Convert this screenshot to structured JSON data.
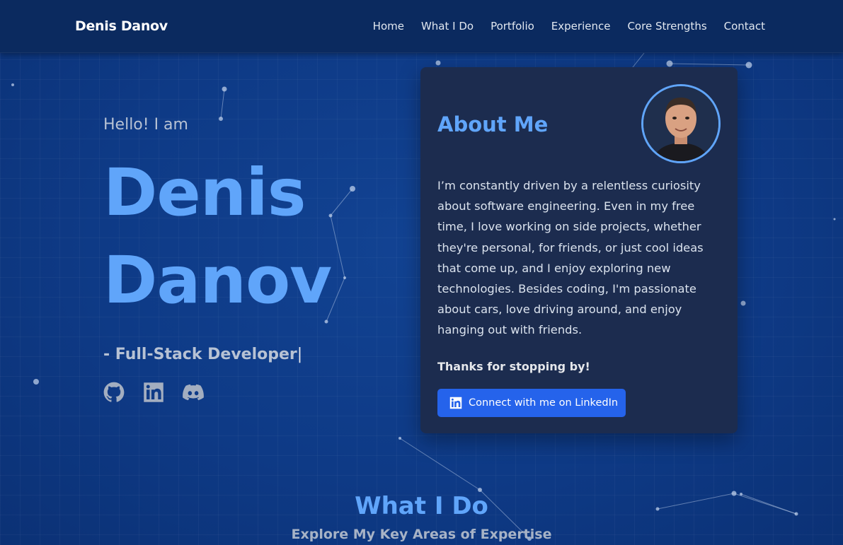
{
  "nav": {
    "brand": "Denis Danov",
    "links": [
      "Home",
      "What I Do",
      "Portfolio",
      "Experience",
      "Core Strengths",
      "Contact"
    ]
  },
  "hero": {
    "greeting": "Hello! I am",
    "first_name": "Denis",
    "last_name": "Danov",
    "subtitle": "- Full-Stack Developer",
    "cursor": "|",
    "socials": [
      "github-icon",
      "linkedin-icon",
      "discord-icon"
    ]
  },
  "about": {
    "title": "About Me",
    "text": "I’m constantly driven by a relentless curiosity about software engineering. Even in my free time, I love working on side projects, whether they're personal, for friends, or just cool ideas that come up, and I enjoy exploring new technologies. Besides coding, I'm passionate about cars, love driving around, and enjoy hanging out with friends.",
    "thanks": "Thanks for stopping by!",
    "button_label": "Connect with me on LinkedIn"
  },
  "what_i_do": {
    "title": "What I Do",
    "subtitle": "Explore My Key Areas of Expertise"
  },
  "colors": {
    "accent": "#60a5fa",
    "button": "#2563eb",
    "background": "#0f3a85",
    "card": "#1c2c4f"
  }
}
